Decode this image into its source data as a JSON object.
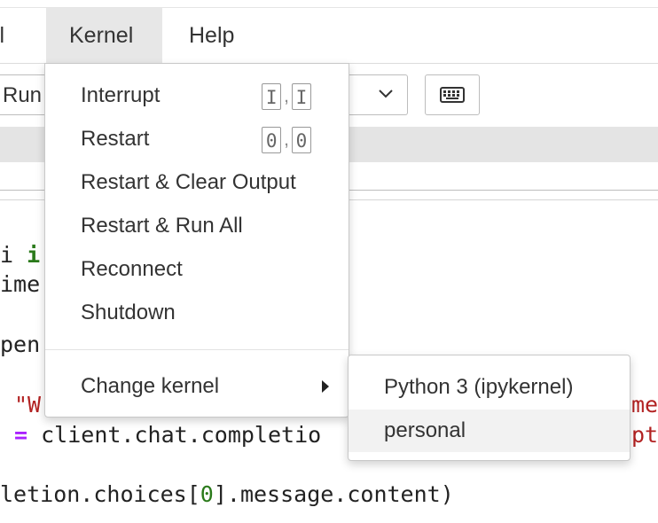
{
  "menubar": {
    "cell_label": "ell",
    "kernel_label": "Kernel",
    "help_label": "Help"
  },
  "toolbar": {
    "run_label": "Run"
  },
  "code": {
    "line1_a": "i ",
    "line1_kw": "i",
    "line2": "ime",
    "line3": "pen",
    "line4_str": "\"W",
    "line4_tail": "me",
    "line5_op": "=",
    "line5_text": " client.chat.completio",
    "line5_tail": "pt",
    "line6_a": "letion.choices[",
    "line6_num": "0",
    "line6_b": "].message.content)"
  },
  "kernel_menu": {
    "items": [
      {
        "label": "Interrupt",
        "shortcut": [
          "I",
          "I"
        ]
      },
      {
        "label": "Restart",
        "shortcut": [
          "0",
          "0"
        ]
      },
      {
        "label": "Restart & Clear Output"
      },
      {
        "label": "Restart & Run All"
      },
      {
        "label": "Reconnect"
      },
      {
        "label": "Shutdown"
      },
      {
        "label": "Change kernel"
      }
    ]
  },
  "change_kernel_submenu": {
    "items": [
      {
        "label": "Python 3 (ipykernel)"
      },
      {
        "label": "personal",
        "highlighted": true
      }
    ]
  }
}
